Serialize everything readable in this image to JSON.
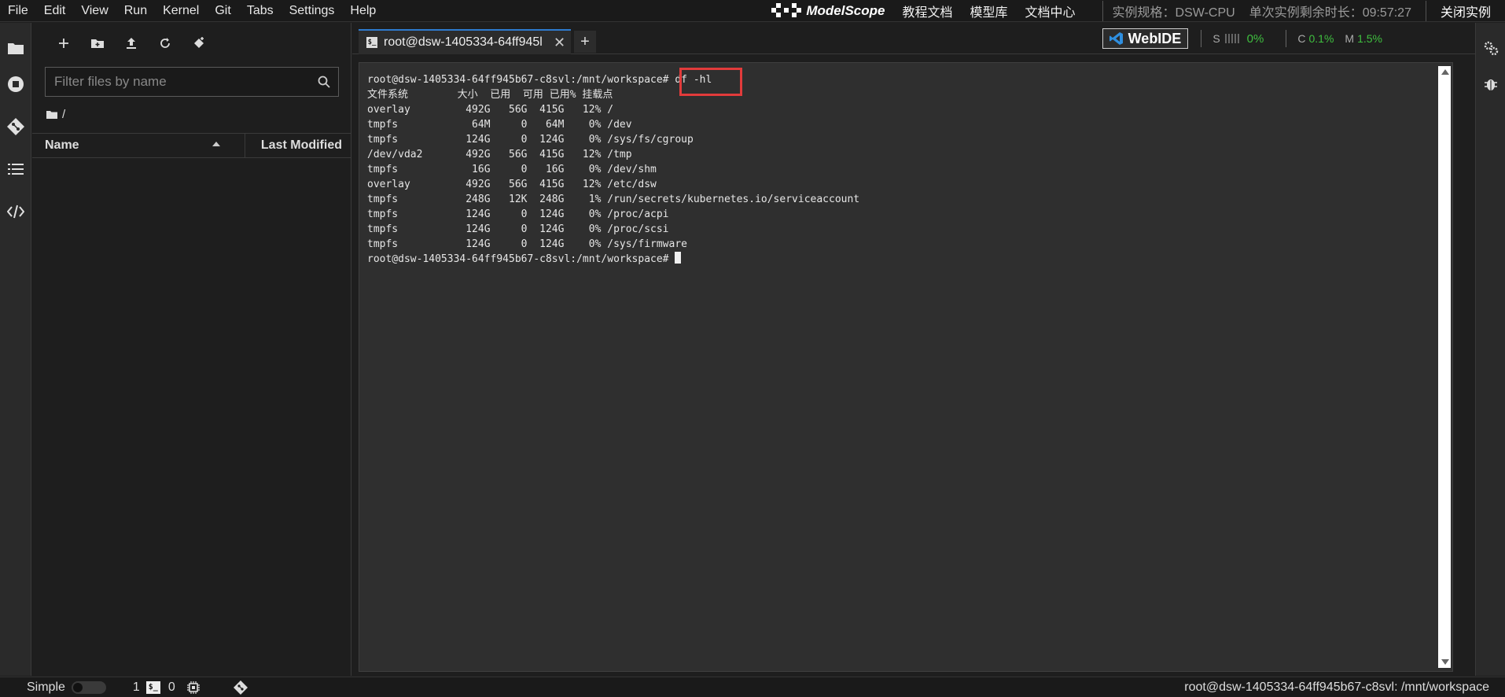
{
  "menu": [
    "File",
    "Edit",
    "View",
    "Run",
    "Kernel",
    "Git",
    "Tabs",
    "Settings",
    "Help"
  ],
  "topbar": {
    "brand": "ModelScope",
    "links": [
      "教程文档",
      "模型库",
      "文档中心"
    ],
    "instance_spec": "实例规格：DSW-CPU",
    "remaining_time": "单次实例剩余时长：09:57:27",
    "close_instance": "关闭实例"
  },
  "filebrowser": {
    "search_placeholder": "Filter files by name",
    "breadcrumb": "/",
    "col_name": "Name",
    "col_modified": "Last Modified"
  },
  "tabs": {
    "active_label": "root@dsw-1405334-64ff945l",
    "add": "+"
  },
  "webide": {
    "label": "WebIDE",
    "s_label": "S",
    "s_value": "0%",
    "c_label": "C",
    "c_value": "0.1%",
    "m_label": "M",
    "m_value": "1.5%"
  },
  "terminal": {
    "lines": [
      "root@dsw-1405334-64ff945b67-c8svl:/mnt/workspace# df -hl",
      "文件系统        大小  已用  可用 已用% 挂载点",
      "overlay         492G   56G  415G   12% /",
      "tmpfs            64M     0   64M    0% /dev",
      "tmpfs           124G     0  124G    0% /sys/fs/cgroup",
      "/dev/vda2       492G   56G  415G   12% /tmp",
      "tmpfs            16G     0   16G    0% /dev/shm",
      "overlay         492G   56G  415G   12% /etc/dsw",
      "tmpfs           248G   12K  248G    1% /run/secrets/kubernetes.io/serviceaccount",
      "tmpfs           124G     0  124G    0% /proc/acpi",
      "tmpfs           124G     0  124G    0% /proc/scsi",
      "tmpfs           124G     0  124G    0% /sys/firmware",
      "root@dsw-1405334-64ff945b67-c8svl:/mnt/workspace# "
    ]
  },
  "statusbar": {
    "mode": "Simple",
    "kernels": "1",
    "terminals": "0",
    "path": "root@dsw-1405334-64ff945b67-c8svl: /mnt/workspace"
  }
}
